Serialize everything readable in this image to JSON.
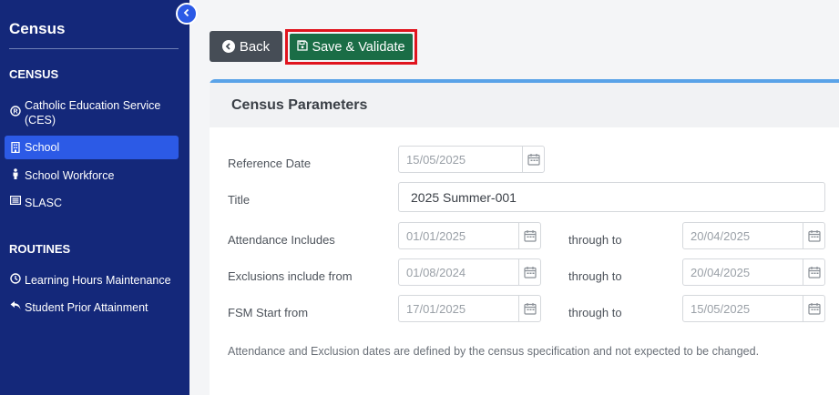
{
  "sidebar": {
    "title": "Census",
    "census_section": "CENSUS",
    "census_items": [
      {
        "label": "Catholic Education Service (CES)",
        "icon": "registered-icon"
      },
      {
        "label": "School",
        "icon": "building-icon"
      },
      {
        "label": "School Workforce",
        "icon": "person-icon"
      },
      {
        "label": "SLASC",
        "icon": "list-icon"
      }
    ],
    "routines_section": "ROUTINES",
    "routine_items": [
      {
        "label": "Learning Hours Maintenance",
        "icon": "clock-icon"
      },
      {
        "label": "Student Prior Attainment",
        "icon": "reply-icon"
      }
    ],
    "collapse_icon": "chevron-left-icon",
    "active_item": "School"
  },
  "toolbar": {
    "back_label": "Back",
    "save_label": "Save & Validate"
  },
  "card": {
    "title": "Census Parameters",
    "reference_date": {
      "label": "Reference Date",
      "value": "15/05/2025"
    },
    "title_field": {
      "label": "Title",
      "value": "2025 Summer-001"
    },
    "attendance": {
      "label": "Attendance Includes",
      "from": "01/01/2025",
      "through_label": "through to",
      "to": "20/04/2025"
    },
    "exclusions": {
      "label": "Exclusions include from",
      "from": "01/08/2024",
      "through_label": "through to",
      "to": "20/04/2025"
    },
    "fsm": {
      "label": "FSM Start from",
      "from": "17/01/2025",
      "through_label": "through to",
      "to": "15/05/2025"
    },
    "note": "Attendance and Exclusion dates are defined by the census specification and not expected to be changed."
  },
  "colors": {
    "sidebar_bg": "#14287a",
    "active_bg": "#2c5ae6",
    "save_bg": "#1a6d46",
    "highlight_border": "#e0141e",
    "card_accent": "#5aa3e8"
  }
}
